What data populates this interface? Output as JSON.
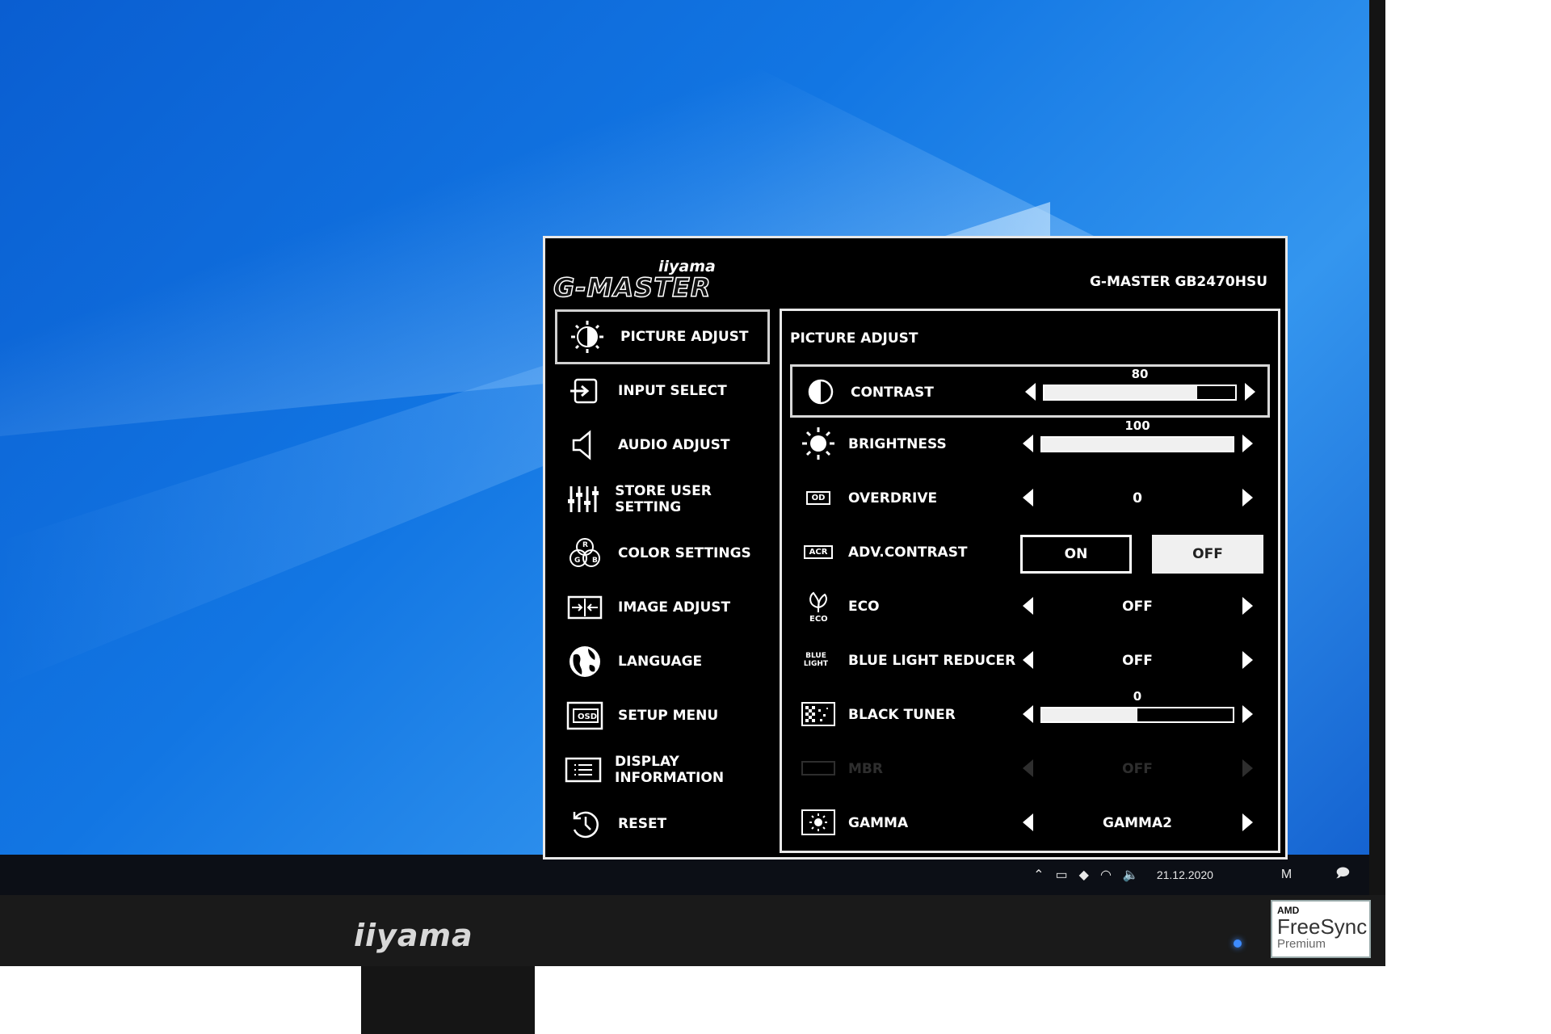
{
  "osd": {
    "brand": "iiyama",
    "logo": "G-MASTER",
    "model": "G-MASTER GB2470HSU",
    "menu": [
      {
        "label": "PICTURE ADJUST",
        "icon": "picture-adjust-icon",
        "selected": true
      },
      {
        "label": "INPUT SELECT",
        "icon": "input-select-icon"
      },
      {
        "label": "AUDIO ADJUST",
        "icon": "speaker-icon"
      },
      {
        "label": "STORE USER SETTING",
        "icon": "sliders-icon"
      },
      {
        "label": "COLOR SETTINGS",
        "icon": "rgb-icon"
      },
      {
        "label": "IMAGE ADJUST",
        "icon": "image-adjust-icon"
      },
      {
        "label": "LANGUAGE",
        "icon": "globe-icon"
      },
      {
        "label": "SETUP MENU",
        "icon": "osd-icon"
      },
      {
        "label": "DISPLAY INFORMATION",
        "icon": "info-list-icon"
      },
      {
        "label": "RESET",
        "icon": "reset-icon"
      }
    ],
    "panel": {
      "title": "PICTURE ADJUST",
      "contrast": {
        "label": "CONTRAST",
        "value": "80",
        "level": 0.8
      },
      "brightness": {
        "label": "BRIGHTNESS",
        "value": "100",
        "level": 1.0
      },
      "overdrive": {
        "label": "OVERDRIVE",
        "icon_text": "OD",
        "value": "0"
      },
      "adv_contrast": {
        "label": "ADV.CONTRAST",
        "icon_text": "ACR",
        "on": "ON",
        "off": "OFF",
        "selected": "OFF"
      },
      "eco": {
        "label": "ECO",
        "icon_text": "ECO",
        "value": "OFF"
      },
      "blue_light": {
        "label": "BLUE LIGHT REDUCER",
        "icon_text": "BLUE LIGHT",
        "value": "OFF"
      },
      "black_tuner": {
        "label": "BLACK TUNER",
        "value": "0",
        "level": 0.5
      },
      "mbr": {
        "label": "MBR",
        "value": "OFF"
      },
      "gamma": {
        "label": "GAMMA",
        "value": "GAMMA2"
      }
    }
  },
  "taskbar": {
    "date": "21.12.2020"
  },
  "bezel": {
    "brand": "iiyama"
  },
  "badge": {
    "amd": "AMD",
    "freesync": "FreeSync",
    "premium": "Premium"
  }
}
